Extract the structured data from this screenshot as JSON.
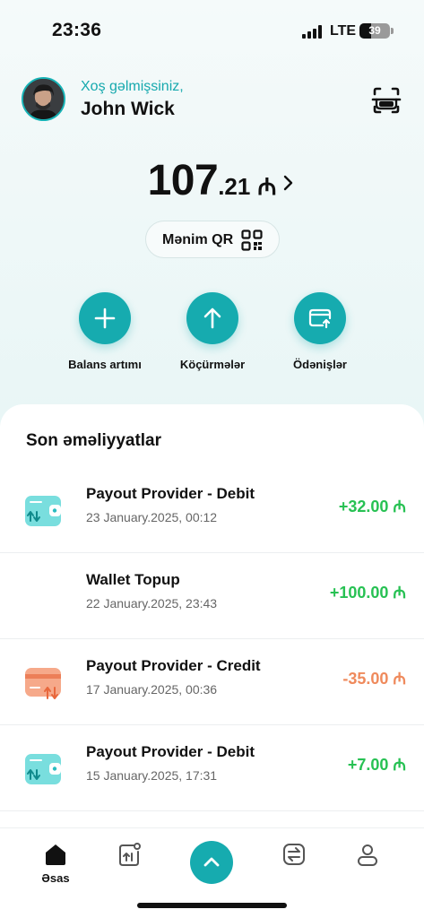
{
  "status": {
    "time": "23:36",
    "network": "LTE",
    "battery": "39"
  },
  "header": {
    "welcome": "Xoş gəlmişsiniz,",
    "user_name": "John Wick"
  },
  "balance": {
    "integer": "107",
    "decimal": ".21",
    "currency": "₼"
  },
  "qr_button": {
    "label": "Mənim QR"
  },
  "actions": [
    {
      "label": "Balans artımı",
      "icon": "plus-icon"
    },
    {
      "label": "Köçürmələr",
      "icon": "arrow-up-icon"
    },
    {
      "label": "Ödənişlər",
      "icon": "card-payment-icon"
    }
  ],
  "transactions": {
    "title": "Son əməliyyatlar",
    "items": [
      {
        "name": "Payout Provider - Debit",
        "date": "23 January.2025, 00:12",
        "amount": "+32.00 ₼",
        "type": "debit"
      },
      {
        "name": "Wallet Topup",
        "date": "22 January.2025, 23:43",
        "amount": "+100.00 ₼",
        "type": "topup"
      },
      {
        "name": "Payout Provider - Credit",
        "date": "17 January.2025, 00:36",
        "amount": "-35.00 ₼",
        "type": "credit"
      },
      {
        "name": "Payout Provider - Debit",
        "date": "15 January.2025, 17:31",
        "amount": "+7.00 ₼",
        "type": "debit"
      }
    ]
  },
  "nav": {
    "home_label": "Əsas"
  },
  "colors": {
    "accent": "#16abaf",
    "positive": "#27c153",
    "negative": "#ef8a5c"
  }
}
